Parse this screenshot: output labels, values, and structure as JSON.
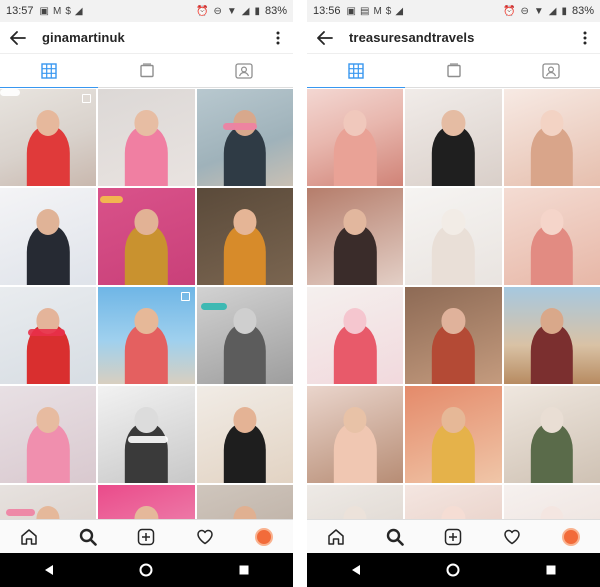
{
  "screens": [
    {
      "status": {
        "time": "13:57",
        "battery": "83%"
      },
      "username": "ginamartinuk",
      "tiles": [
        {
          "bg": "linear-gradient(160deg,#e8e4df 0%,#d9d2cc 55%,#c9b8ae 100%)",
          "shirt": "#e03a3a",
          "skin": "#e6b89c",
          "multi": true
        },
        {
          "bg": "linear-gradient(160deg,#dcd8d6 0%,#e9e3e0 100%)",
          "shirt": "#f07fa2",
          "skin": "#e7bda3",
          "multi": false
        },
        {
          "bg": "linear-gradient(160deg,#b8c8cf 0%,#9fb2ba 60%,#c9c0b4 100%)",
          "shirt": "#2f3b45",
          "skin": "#d8a88c",
          "multi": false
        },
        {
          "bg": "linear-gradient(160deg,#f4f4f6 0%,#dfe3ea 100%)",
          "shirt": "#262a33",
          "skin": "#e0b397",
          "multi": false
        },
        {
          "bg": "linear-gradient(160deg,#d9528a 0%,#c94079 100%)",
          "shirt": "#c9922f",
          "skin": "#e2b295",
          "multi": false
        },
        {
          "bg": "linear-gradient(160deg,#5a4a3a 0%,#7a6550 100%)",
          "shirt": "#d78b2a",
          "skin": "#e5b596",
          "multi": false
        },
        {
          "bg": "linear-gradient(160deg,#e9ecef 0%,#d7dde3 100%)",
          "shirt": "#d92f2f",
          "skin": "#e4b49a",
          "multi": false
        },
        {
          "bg": "linear-gradient(180deg,#6fb6e6 0%,#9fd0ee 55%,#d8cfc0 100%)",
          "shirt": "#e46060",
          "skin": "#e6b898",
          "multi": true
        },
        {
          "bg": "linear-gradient(160deg,#d2d2d2 0%,#9e9e9e 100%)",
          "shirt": "#5c5c5c",
          "skin": "#cfcfcf",
          "multi": false
        },
        {
          "bg": "linear-gradient(160deg,#e8e0e4 0%,#d9c9cf 100%)",
          "shirt": "#f08fae",
          "skin": "#e7bba0",
          "multi": false
        },
        {
          "bg": "linear-gradient(160deg,#f2f2f2 0%,#c8c8c8 100%)",
          "shirt": "#3a3a3a",
          "skin": "#dcdcdc",
          "multi": false
        },
        {
          "bg": "linear-gradient(160deg,#f1ece6 0%,#e2d3c3 100%)",
          "shirt": "#1e1e1e",
          "skin": "#e4b395",
          "multi": false
        },
        {
          "bg": "linear-gradient(160deg,#e7e2df 0%,#d4cac4 100%)",
          "shirt": "#c64d4d",
          "skin": "#e5b89a",
          "multi": false
        },
        {
          "bg": "linear-gradient(160deg,#ea4b8a 0%,#f0a0c0 100%)",
          "shirt": "#d6303a",
          "skin": "#e5b89a",
          "multi": false
        },
        {
          "bg": "linear-gradient(160deg,#cfc6bd 0%,#b6a79b 100%)",
          "shirt": "#3c3c3c",
          "skin": "#e0b091",
          "multi": false
        }
      ]
    },
    {
      "status": {
        "time": "13:56",
        "battery": "83%"
      },
      "username": "treasuresandtravels",
      "tiles": [
        {
          "bg": "linear-gradient(160deg,#f3d7d2 0%,#e8b7ae 45%,#d08377 100%)",
          "shirt": "#e9a296",
          "skin": "#f0c8bc",
          "multi": false
        },
        {
          "bg": "linear-gradient(160deg,#f1ece9 0%,#d9cfc9 100%)",
          "shirt": "#1f1f1f",
          "skin": "#e5bca3",
          "multi": false
        },
        {
          "bg": "linear-gradient(160deg,#f7eae4 0%,#e6bfae 100%)",
          "shirt": "#d9a58a",
          "skin": "#f3d3c4",
          "multi": false
        },
        {
          "bg": "linear-gradient(160deg,#b57d6b 0%,#e3cfc6 100%)",
          "shirt": "#3a2c2a",
          "skin": "#e2b79e",
          "multi": false
        },
        {
          "bg": "linear-gradient(160deg,#f6f4f2 0%,#e9e4e0 100%)",
          "shirt": "#e9dfd7",
          "skin": "#f2ece6",
          "multi": false
        },
        {
          "bg": "linear-gradient(160deg,#f4dcd3 0%,#e7b7a7 100%)",
          "shirt": "#e28b82",
          "skin": "#f5d5ca",
          "multi": false
        },
        {
          "bg": "linear-gradient(160deg,#f4f0ee 0%,#f2d9dd 100%)",
          "shirt": "#e85a6a",
          "skin": "#f5c6cf",
          "multi": false
        },
        {
          "bg": "linear-gradient(160deg,#8d6a55 0%,#c49b7e 100%)",
          "shirt": "#b44a35",
          "skin": "#e0b29b",
          "multi": false
        },
        {
          "bg": "linear-gradient(180deg,#a6c8e0 0%,#d9c2a5 60%,#b78b61 100%)",
          "shirt": "#7b2f2f",
          "skin": "#d9a88a",
          "multi": false
        },
        {
          "bg": "linear-gradient(160deg,#ead5cc 0%,#b78d75 100%)",
          "shirt": "#f0c7b2",
          "skin": "#e8c2a7",
          "multi": false
        },
        {
          "bg": "linear-gradient(160deg,#e48a6a 0%,#f0c6a8 100%)",
          "shirt": "#e5b24a",
          "skin": "#e6b897",
          "multi": false
        },
        {
          "bg": "linear-gradient(160deg,#efe7df 0%,#cfc2b4 100%)",
          "shirt": "#5a6b4a",
          "skin": "#e9ded4",
          "multi": false
        },
        {
          "bg": "linear-gradient(160deg,#eeeae6 0%,#d8cfc7 100%)",
          "shirt": "#c7b3a3",
          "skin": "#ece2da",
          "multi": false
        },
        {
          "bg": "linear-gradient(160deg,#f4e6e1 0%,#e3c6bb 100%)",
          "shirt": "#f2b5a9",
          "skin": "#f5ddd4",
          "multi": false
        },
        {
          "bg": "linear-gradient(160deg,#f6f1ef 0%,#eadcd6 100%)",
          "shirt": "#e7c9c0",
          "skin": "#f4e6e1",
          "multi": false
        }
      ]
    }
  ],
  "icons": {
    "back": "arrow-left-icon",
    "more": "more-vertical-icon",
    "grid": "grid-icon",
    "feed": "feed-icon",
    "tagged": "tagged-icon",
    "home": "home-icon",
    "search": "search-icon",
    "add": "add-icon",
    "activity": "heart-icon",
    "profile": "avatar",
    "sys_back": "triangle-back-icon",
    "sys_home": "circle-home-icon",
    "sys_recent": "square-recent-icon"
  },
  "colors": {
    "accent": "#3897f0",
    "avatar": "#f26b3a"
  }
}
